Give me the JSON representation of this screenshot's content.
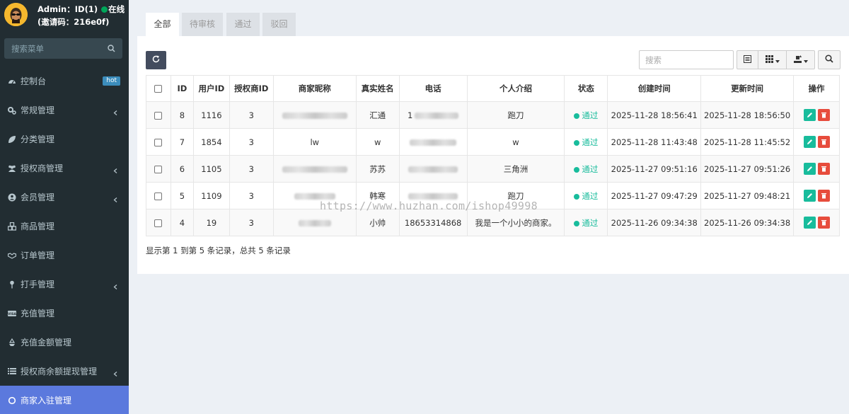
{
  "user": {
    "line1_prefix": "Admin：ID(1)",
    "status": "在线",
    "line2": "(邀请码：216e0f)"
  },
  "sidebar": {
    "search_placeholder": "搜索菜单",
    "items": [
      {
        "label": "控制台",
        "icon": "dashboard-icon",
        "badge": "hot",
        "chevron": false,
        "active": false
      },
      {
        "label": "常规管理",
        "icon": "cogs-icon",
        "chevron": true,
        "active": false
      },
      {
        "label": "分类管理",
        "icon": "leaf-icon",
        "chevron": false,
        "active": false
      },
      {
        "label": "授权商管理",
        "icon": "users-icon",
        "chevron": true,
        "active": false
      },
      {
        "label": "会员管理",
        "icon": "user-circle-icon",
        "chevron": true,
        "active": false
      },
      {
        "label": "商品管理",
        "icon": "cubes-icon",
        "chevron": false,
        "active": false
      },
      {
        "label": "订单管理",
        "icon": "handshake-icon",
        "chevron": false,
        "active": false
      },
      {
        "label": "打手管理",
        "icon": "pin-icon",
        "chevron": true,
        "active": false
      },
      {
        "label": "充值管理",
        "icon": "visa-card-icon",
        "chevron": false,
        "active": false
      },
      {
        "label": "充值金额管理",
        "icon": "recycle-icon",
        "chevron": false,
        "active": false
      },
      {
        "label": "授权商余额提现管理",
        "icon": "list-icon",
        "chevron": true,
        "active": false
      },
      {
        "label": "商家入驻管理",
        "icon": "circle-o-icon",
        "chevron": false,
        "active": true
      }
    ]
  },
  "tabs": [
    {
      "label": "全部",
      "active": true
    },
    {
      "label": "待审核",
      "active": false
    },
    {
      "label": "通过",
      "active": false
    },
    {
      "label": "驳回",
      "active": false
    }
  ],
  "toolbar": {
    "search_placeholder": "搜索"
  },
  "table": {
    "headers": [
      "ID",
      "用户ID",
      "授权商ID",
      "商家昵称",
      "真实姓名",
      "电话",
      "个人介绍",
      "状态",
      "创建时间",
      "更新时间",
      "操作"
    ],
    "rows": [
      {
        "id": "8",
        "user_id": "1116",
        "agent_id": "3",
        "nickname": "",
        "realname": "汇通",
        "phone": "1",
        "intro": "跑刀",
        "status": "通过",
        "created": "2025-11-28 18:56:41",
        "updated": "2025-11-28 18:56:50"
      },
      {
        "id": "7",
        "user_id": "1854",
        "agent_id": "3",
        "nickname": "lw",
        "realname": "w",
        "phone": "",
        "intro": "w",
        "status": "通过",
        "created": "2025-11-28 11:43:48",
        "updated": "2025-11-28 11:45:52"
      },
      {
        "id": "6",
        "user_id": "1105",
        "agent_id": "3",
        "nickname": "",
        "realname": "苏苏",
        "phone": "",
        "intro": "三角洲",
        "status": "通过",
        "created": "2025-11-27 09:51:16",
        "updated": "2025-11-27 09:51:26"
      },
      {
        "id": "5",
        "user_id": "1109",
        "agent_id": "3",
        "nickname": "",
        "realname": "韩寒",
        "phone": "",
        "intro": "跑刀",
        "status": "通过",
        "created": "2025-11-27 09:47:29",
        "updated": "2025-11-27 09:48:21"
      },
      {
        "id": "4",
        "user_id": "19",
        "agent_id": "3",
        "nickname": "",
        "realname": "小帅",
        "phone": "18653314868",
        "intro": "我是一个小小的商家。",
        "status": "通过",
        "created": "2025-11-26 09:34:38",
        "updated": "2025-11-26 09:34:38"
      }
    ]
  },
  "pagination": {
    "info": "显示第 1 到第 5 条记录，总共 5 条记录"
  },
  "watermark": "https://www.huzhan.com/ishop49998",
  "colors": {
    "sidebar_bg": "#222d32",
    "active_item": "#5b79dd",
    "success": "#18bc9c",
    "danger": "#e74c3c"
  }
}
